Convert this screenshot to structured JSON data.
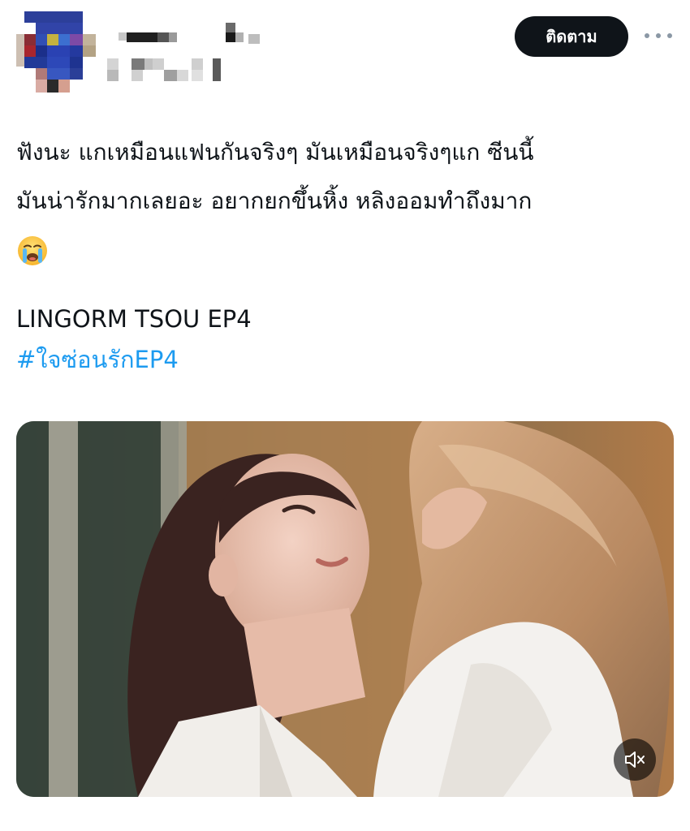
{
  "header": {
    "follow_label": "ติดตาม",
    "more_icon": "more-horizontal-icon"
  },
  "tweet": {
    "lines": [
      "ฟังนะ แกเหมือนแฟนกันจริงๆ มันเหมือนจริงๆแก ซีนนี้",
      "มันน่ารักมากเลยอะ อยากยกขึ้นหิ้ง หลิงออมทำถึงมาก"
    ],
    "emoji": "loudly-crying-face-emoji",
    "caption": "LINGORM TSOU EP4",
    "hashtag": "#ใจซ่อนรักEP4"
  },
  "media": {
    "type": "video",
    "mute_icon": "speaker-muted-icon"
  },
  "colors": {
    "text": "#0f1419",
    "link": "#1d9bf0",
    "button_bg": "#0f1419",
    "button_text": "#ffffff",
    "muted": "#8b98a5"
  }
}
